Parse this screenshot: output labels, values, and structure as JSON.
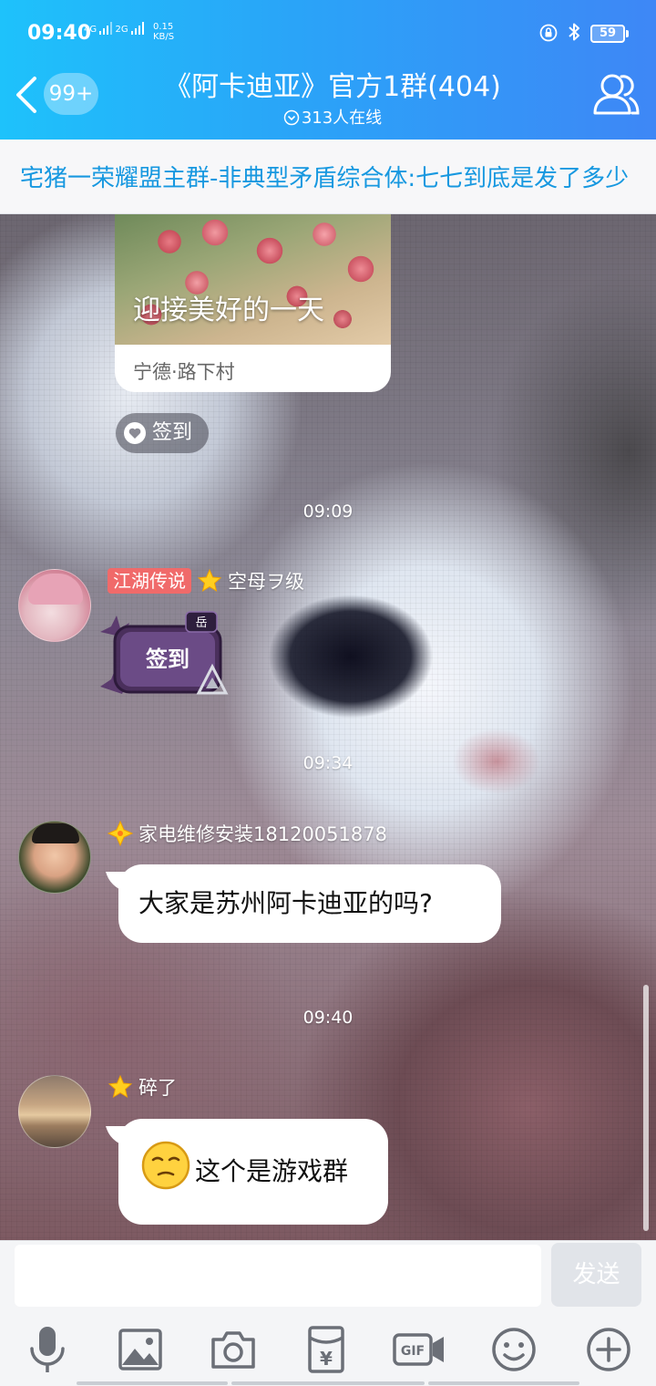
{
  "status_bar": {
    "time": "09:40",
    "net_4g": "4G",
    "net_2g": "2G",
    "speed_value": "0.15",
    "speed_unit": "KB/S",
    "battery": "59"
  },
  "header": {
    "unread_badge": "99+",
    "title": "《阿卡迪亚》官方1群(404)",
    "online_text": "313人在线"
  },
  "notice": {
    "text": "宅猪一荣耀盟主群-非典型矛盾综合体:七七到底是发了多少"
  },
  "messages": {
    "card": {
      "caption": "迎接美好的一天",
      "location": "宁德·路下村"
    },
    "checkin_label": "签到",
    "timestamps": [
      "09:09",
      "09:34",
      "09:40"
    ],
    "msg1": {
      "title_tag": "江湖传说",
      "nickname": "空母ヲ级",
      "sticker_text": "签到",
      "sticker_badge": "岳"
    },
    "msg2": {
      "nickname": "家电维修安装18120051878",
      "text": "大家是苏州阿卡迪亚的吗?"
    },
    "msg3": {
      "nickname": "碎了",
      "text": "这个是游戏群"
    }
  },
  "input": {
    "placeholder": "",
    "send_label": "发送"
  },
  "toolbar_icons": [
    "microphone-icon",
    "image-icon",
    "camera-icon",
    "red-packet-icon",
    "gif-icon",
    "emoji-icon",
    "plus-icon"
  ],
  "colors": {
    "header_start": "#1ec2fb",
    "header_end": "#3e87f6",
    "notice_text": "#1798e0",
    "title_tag_bg": "#f06a6a"
  }
}
